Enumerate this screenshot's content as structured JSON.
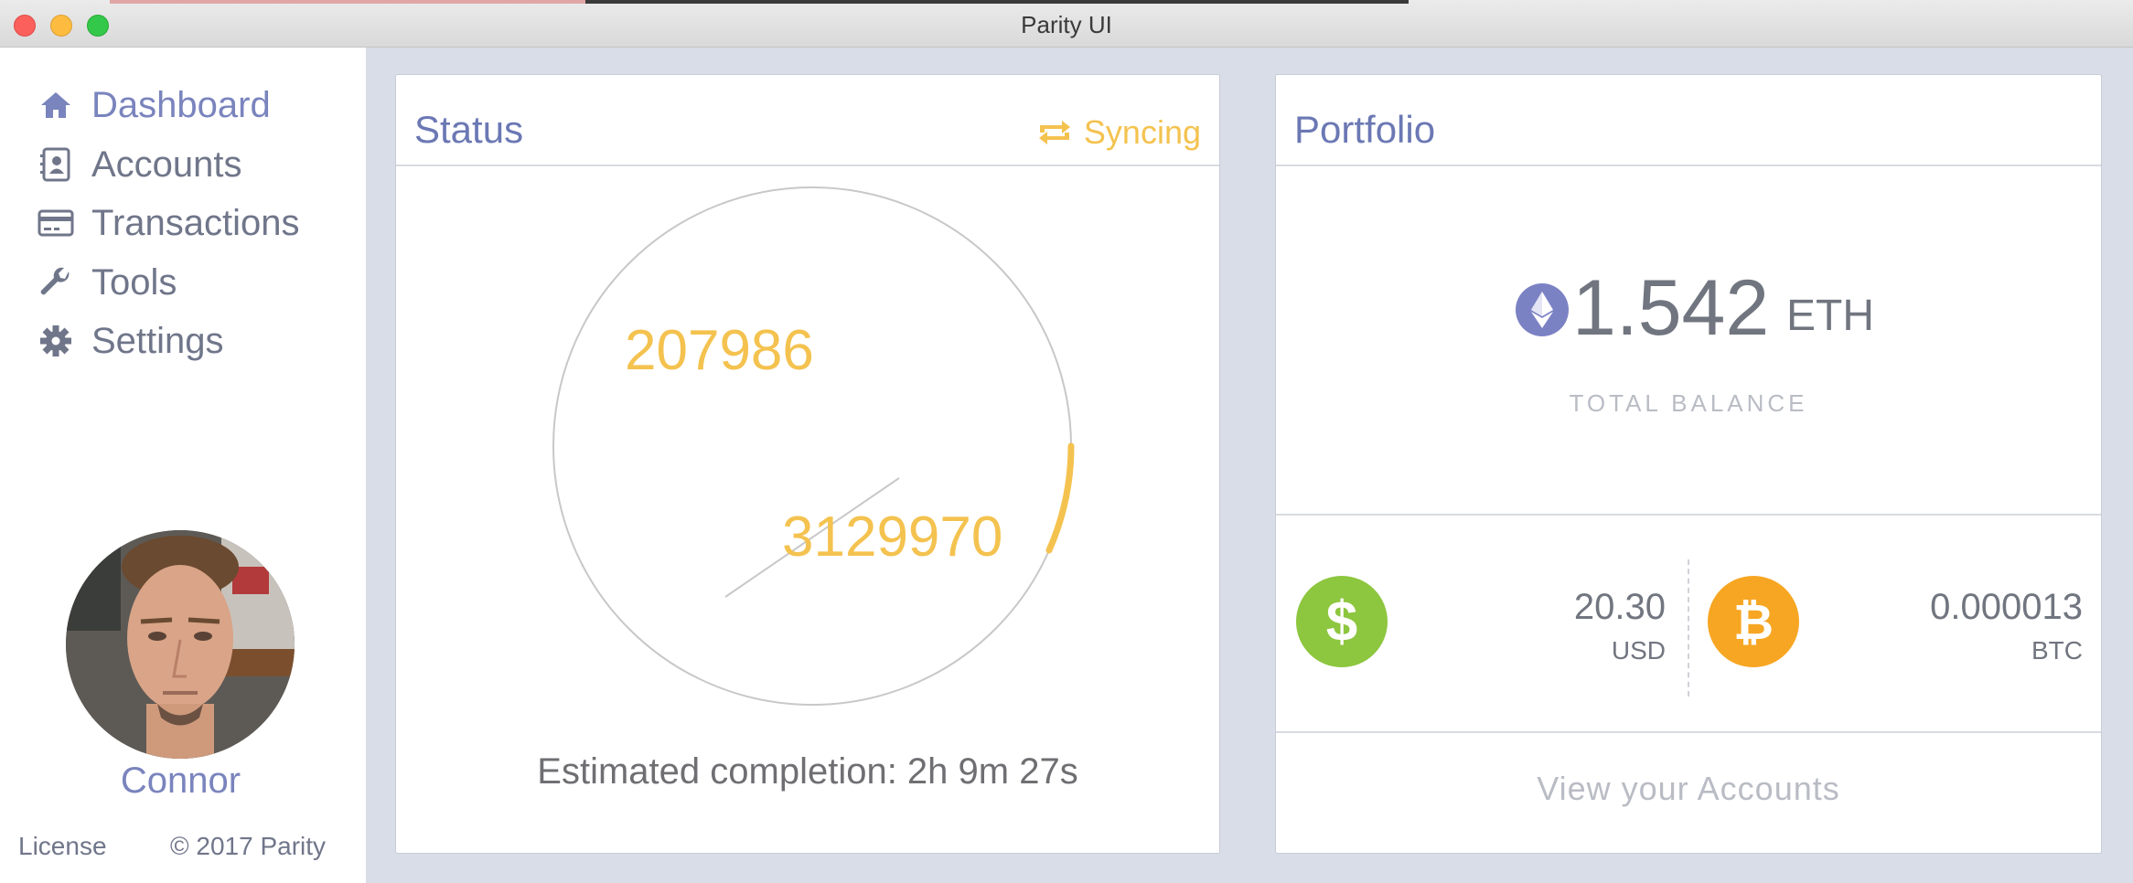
{
  "window": {
    "title": "Parity UI"
  },
  "sidebar": {
    "items": [
      {
        "label": "Dashboard",
        "icon": "home-icon",
        "active": true
      },
      {
        "label": "Accounts",
        "icon": "contact-book-icon",
        "active": false
      },
      {
        "label": "Transactions",
        "icon": "credit-card-icon",
        "active": false
      },
      {
        "label": "Tools",
        "icon": "wrench-icon",
        "active": false
      },
      {
        "label": "Settings",
        "icon": "gear-icon",
        "active": false
      }
    ],
    "user": {
      "name": "Connor"
    },
    "footer": {
      "license": "License",
      "copyright": "© 2017 Parity"
    }
  },
  "status": {
    "title": "Status",
    "sync_state": "Syncing",
    "current_block": "207986",
    "highest_block": "3129970",
    "eta": "Estimated completion: 2h 9m 27s",
    "progress_fraction": 0.066
  },
  "portfolio": {
    "title": "Portfolio",
    "balance_amount": "1.542",
    "balance_unit": "ETH",
    "balance_label": "TOTAL BALANCE",
    "usd_amount": "20.30",
    "usd_unit": "USD",
    "btc_amount": "0.000013",
    "btc_unit": "BTC",
    "view_accounts": "View your Accounts"
  },
  "colors": {
    "accent": "#7a84bd",
    "sync_yellow": "#f4c24f",
    "usd_green": "#8dc63f",
    "btc_orange": "#f7a623",
    "eth_purple": "#7b82c4"
  }
}
